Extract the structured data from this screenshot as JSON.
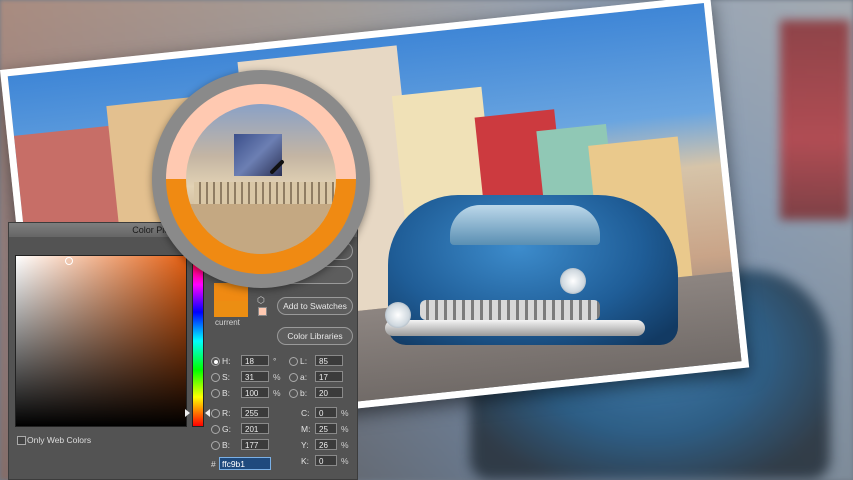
{
  "dialog": {
    "title": "Color Picker (Filter Color)",
    "buttons": {
      "ok": "",
      "cancel": "",
      "add_to_swatches": "Add to Swatches",
      "color_libraries": "Color Libraries"
    },
    "current_label": "current",
    "only_web_colors": "Only Web Colors",
    "hsb": {
      "h": {
        "label": "H:",
        "value": "18",
        "unit": "°"
      },
      "s": {
        "label": "S:",
        "value": "31",
        "unit": "%"
      },
      "b": {
        "label": "B:",
        "value": "100",
        "unit": "%"
      }
    },
    "rgb": {
      "r": {
        "label": "R:",
        "value": "255"
      },
      "g": {
        "label": "G:",
        "value": "201"
      },
      "b": {
        "label": "B:",
        "value": "177"
      }
    },
    "lab": {
      "l": {
        "label": "L:",
        "value": "85"
      },
      "a": {
        "label": "a:",
        "value": "17"
      },
      "b": {
        "label": "b:",
        "value": "20"
      }
    },
    "cmyk": {
      "c": {
        "label": "C:",
        "value": "0",
        "unit": "%"
      },
      "m": {
        "label": "M:",
        "value": "25",
        "unit": "%"
      },
      "y": {
        "label": "Y:",
        "value": "26",
        "unit": "%"
      },
      "k": {
        "label": "K:",
        "value": "0",
        "unit": "%"
      }
    },
    "hex_hash": "#",
    "hex": "ffc9b1"
  },
  "colors": {
    "sampled": "#ffc9b1",
    "current": "#f08a12"
  },
  "icons": {
    "loupe": "magnifier-loupe",
    "eyedropper": "eyedropper-icon",
    "cube": "cube-icon"
  }
}
